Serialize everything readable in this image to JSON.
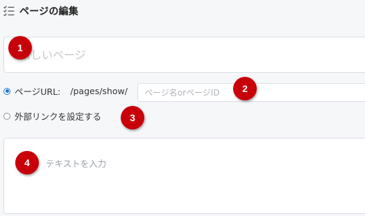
{
  "header": {
    "title": "ページの編集",
    "icon": "checklist-icon"
  },
  "title_field": {
    "placeholder": "新しいページ",
    "value": ""
  },
  "url_option": {
    "label": "ページURL:",
    "prefix": "/pages/show/",
    "selected": true,
    "slug_placeholder": "ページ名orページID",
    "slug_value": ""
  },
  "external_option": {
    "label": "外部リンクを設定する",
    "selected": false
  },
  "body_field": {
    "placeholder": "テキストを入力",
    "value": ""
  },
  "callouts": [
    "1",
    "2",
    "3",
    "4"
  ],
  "colors": {
    "callout": "#c8000a",
    "radio_selected": "#1a73c8",
    "background": "#f6f7f9"
  }
}
